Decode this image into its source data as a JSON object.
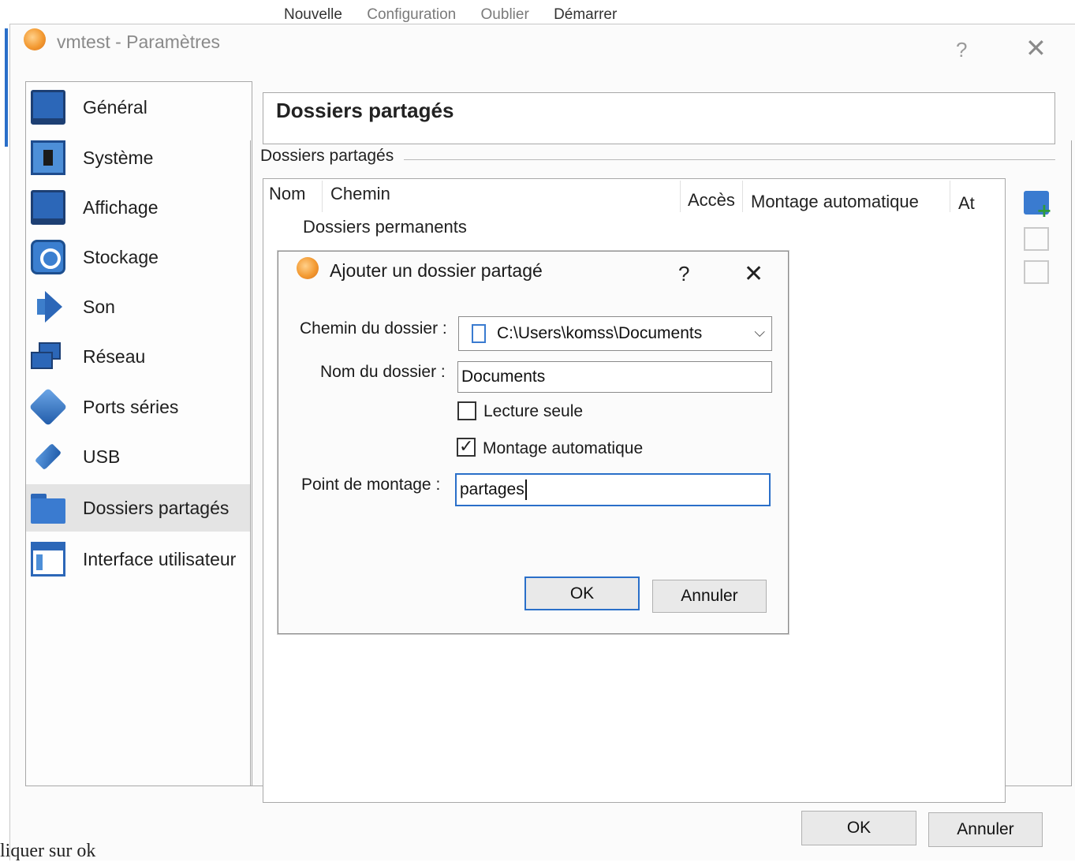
{
  "background_menu": {
    "items": [
      "Nouvelle",
      "Configuration",
      "Oublier",
      "Démarrer"
    ]
  },
  "window": {
    "title": "vmtest - Paramètres",
    "help_glyph": "?",
    "close_glyph": "✕",
    "title_icon": "virtualbox-orange-ball-icon"
  },
  "sidebar": {
    "items": [
      {
        "label": "Général",
        "icon": "monitor-icon"
      },
      {
        "label": "Système",
        "icon": "chip-icon"
      },
      {
        "label": "Affichage",
        "icon": "display-icon"
      },
      {
        "label": "Stockage",
        "icon": "disk-icon"
      },
      {
        "label": "Son",
        "icon": "speaker-icon"
      },
      {
        "label": "Réseau",
        "icon": "network-icon"
      },
      {
        "label": "Ports séries",
        "icon": "serial-port-icon"
      },
      {
        "label": "USB",
        "icon": "usb-icon"
      },
      {
        "label": "Dossiers partagés",
        "icon": "folder-icon",
        "selected": true
      },
      {
        "label": "Interface utilisateur",
        "icon": "window-layout-icon"
      }
    ]
  },
  "main": {
    "page_title": "Dossiers partagés",
    "section_label": "Dossiers partagés",
    "table": {
      "columns": [
        "Nom",
        "Chemin",
        "Accès",
        "Montage automatique",
        "At"
      ],
      "group_row": "Dossiers permanents"
    },
    "toolbar": [
      "add-shared-folder-icon",
      "edit-shared-folder-icon",
      "remove-shared-folder-icon"
    ]
  },
  "dialog": {
    "title": "Ajouter un dossier partagé",
    "help_glyph": "?",
    "close_glyph": "✕",
    "path_label": "Chemin du dossier :",
    "path_value": "C:\\Users\\komss\\Documents",
    "name_label": "Nom du dossier :",
    "name_value": "Documents",
    "readonly_label": "Lecture seule",
    "readonly_checked": false,
    "automount_label": "Montage automatique",
    "automount_checked": true,
    "mount_label": "Point de montage :",
    "mount_value": "partages",
    "ok": "OK",
    "cancel": "Annuler",
    "chevron": "⌵",
    "checkmark": "✓"
  },
  "footer": {
    "ok": "OK",
    "cancel": "Annuler"
  },
  "caption": "liquer sur ok",
  "colors": {
    "accent": "#2a6fc9",
    "folder_blue": "#3a7bd0"
  }
}
